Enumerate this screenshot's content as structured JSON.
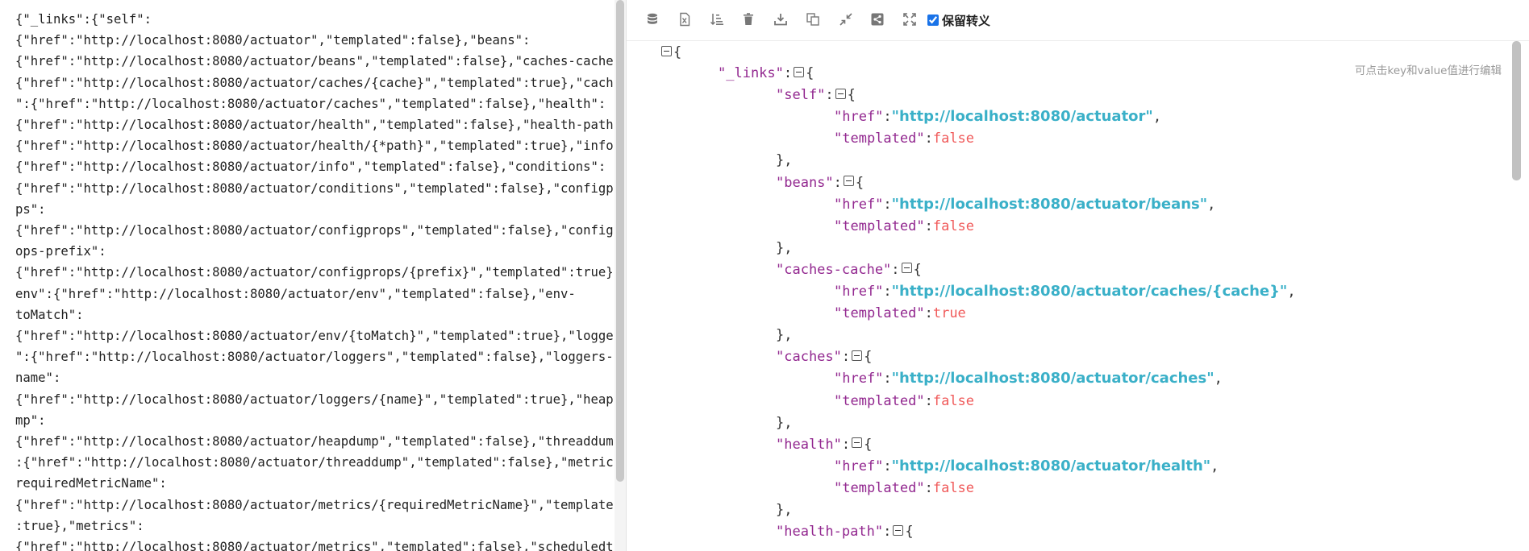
{
  "raw_pane": {
    "lines": [
      "{\"_links\":{\"self\":",
      "{\"href\":\"http://localhost:8080/actuator\",\"templated\":false},\"beans\":",
      "{\"href\":\"http://localhost:8080/actuator/beans\",\"templated\":false},\"caches-cache\":",
      "{\"href\":\"http://localhost:8080/actuator/caches/{cache}\",\"templated\":true},\"caches",
      "\":{\"href\":\"http://localhost:8080/actuator/caches\",\"templated\":false},\"health\":",
      "{\"href\":\"http://localhost:8080/actuator/health\",\"templated\":false},\"health-path\":",
      "{\"href\":\"http://localhost:8080/actuator/health/{*path}\",\"templated\":true},\"info\":",
      "{\"href\":\"http://localhost:8080/actuator/info\",\"templated\":false},\"conditions\":",
      "{\"href\":\"http://localhost:8080/actuator/conditions\",\"templated\":false},\"configprops",
      "ps\":",
      "{\"href\":\"http://localhost:8080/actuator/configprops\",\"templated\":false},\"configpr",
      "ops-prefix\":",
      "{\"href\":\"http://localhost:8080/actuator/configprops/{prefix}\",\"templated\":true},\"",
      "env\":{\"href\":\"http://localhost:8080/actuator/env\",\"templated\":false},\"env-",
      "toMatch\":",
      "{\"href\":\"http://localhost:8080/actuator/env/{toMatch}\",\"templated\":true},\"loggers",
      "\":{\"href\":\"http://localhost:8080/actuator/loggers\",\"templated\":false},\"loggers-",
      "name\":",
      "{\"href\":\"http://localhost:8080/actuator/loggers/{name}\",\"templated\":true},\"heapdu",
      "mp\":",
      "{\"href\":\"http://localhost:8080/actuator/heapdump\",\"templated\":false},\"threaddump\"",
      ":{\"href\":\"http://localhost:8080/actuator/threaddump\",\"templated\":false},\"metrics-",
      "requiredMetricName\":",
      "{\"href\":\"http://localhost:8080/actuator/metrics/{requiredMetricName}\",\"templated\"",
      ":true},\"metrics\":",
      "{\"href\":\"http://localhost:8080/actuator/metrics\",\"templated\":false},\"scheduledtas"
    ]
  },
  "toolbar": {
    "buttons": [
      {
        "name": "database-icon"
      },
      {
        "name": "excel-export-icon"
      },
      {
        "name": "sort-icon"
      },
      {
        "name": "trash-icon"
      },
      {
        "name": "download-icon"
      },
      {
        "name": "copy-icon"
      },
      {
        "name": "compress-icon"
      },
      {
        "name": "share-icon"
      },
      {
        "name": "expand-icon"
      }
    ],
    "escape_checkbox": {
      "label": "保留转义",
      "checked": true
    }
  },
  "tree": {
    "edit_hint": "可点击key和value值进行编辑",
    "root_open": "{",
    "rows": [
      {
        "type": "open",
        "indent": 1,
        "key": "\"_links\""
      },
      {
        "type": "open",
        "indent": 2,
        "key": "\"self\""
      },
      {
        "type": "str",
        "indent": 3,
        "key": "\"href\"",
        "value": "\"http://localhost:8080/actuator\"",
        "comma": ","
      },
      {
        "type": "bool",
        "indent": 3,
        "key": "\"templated\"",
        "value": "false",
        "comma": ""
      },
      {
        "type": "close",
        "indent": 2,
        "text": "},"
      },
      {
        "type": "open",
        "indent": 2,
        "key": "\"beans\""
      },
      {
        "type": "str",
        "indent": 3,
        "key": "\"href\"",
        "value": "\"http://localhost:8080/actuator/beans\"",
        "comma": ","
      },
      {
        "type": "bool",
        "indent": 3,
        "key": "\"templated\"",
        "value": "false",
        "comma": ""
      },
      {
        "type": "close",
        "indent": 2,
        "text": "},"
      },
      {
        "type": "open",
        "indent": 2,
        "key": "\"caches-cache\""
      },
      {
        "type": "str",
        "indent": 3,
        "key": "\"href\"",
        "value": "\"http://localhost:8080/actuator/caches/{cache}\"",
        "comma": ","
      },
      {
        "type": "bool",
        "indent": 3,
        "key": "\"templated\"",
        "value": "true",
        "comma": ""
      },
      {
        "type": "close",
        "indent": 2,
        "text": "},"
      },
      {
        "type": "open",
        "indent": 2,
        "key": "\"caches\""
      },
      {
        "type": "str",
        "indent": 3,
        "key": "\"href\"",
        "value": "\"http://localhost:8080/actuator/caches\"",
        "comma": ","
      },
      {
        "type": "bool",
        "indent": 3,
        "key": "\"templated\"",
        "value": "false",
        "comma": ""
      },
      {
        "type": "close",
        "indent": 2,
        "text": "},"
      },
      {
        "type": "open",
        "indent": 2,
        "key": "\"health\""
      },
      {
        "type": "str",
        "indent": 3,
        "key": "\"href\"",
        "value": "\"http://localhost:8080/actuator/health\"",
        "comma": ","
      },
      {
        "type": "bool",
        "indent": 3,
        "key": "\"templated\"",
        "value": "false",
        "comma": ""
      },
      {
        "type": "close",
        "indent": 2,
        "text": "},"
      },
      {
        "type": "open",
        "indent": 2,
        "key": "\"health-path\""
      }
    ]
  },
  "colors": {
    "key": "#92278f",
    "string": "#3ab0c8",
    "boolean": "#f05a5a"
  }
}
